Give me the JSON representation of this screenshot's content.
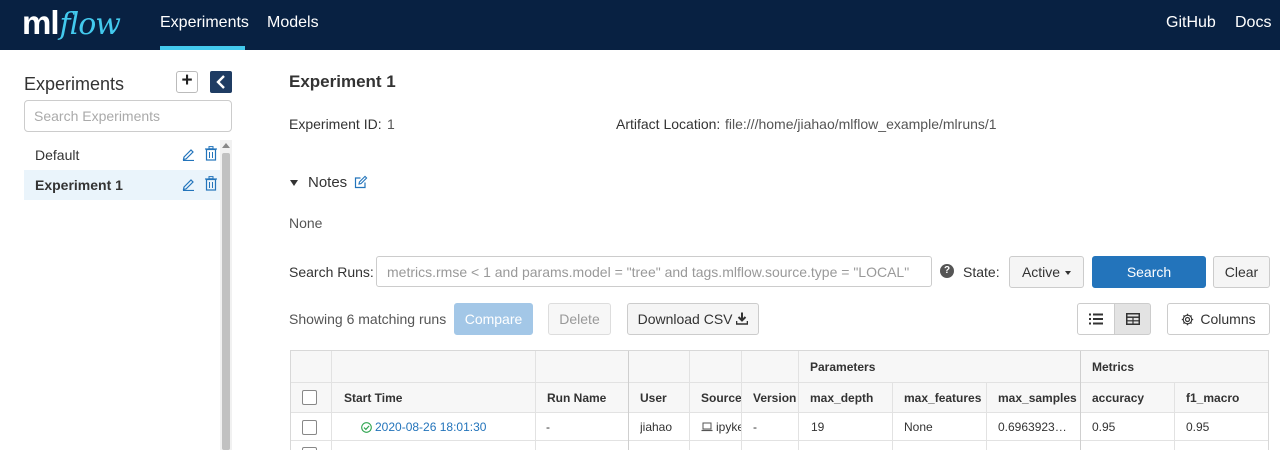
{
  "nav": {
    "logo_ml": "ml",
    "logo_flow": "flow",
    "experiments": "Experiments",
    "models": "Models",
    "github": "GitHub",
    "docs": "Docs"
  },
  "sidebar": {
    "title": "Experiments",
    "add_label": "+",
    "search_placeholder": "Search Experiments",
    "items": [
      {
        "name": "Default",
        "active": false
      },
      {
        "name": "Experiment 1",
        "active": true
      }
    ]
  },
  "experiment": {
    "title": "Experiment 1",
    "id_label": "Experiment ID:",
    "id_value": "1",
    "artifact_label": "Artifact Location:",
    "artifact_value": "file:///home/jiahao/mlflow_example/mlruns/1",
    "notes_label": "Notes",
    "notes_value": "None"
  },
  "search": {
    "label": "Search Runs:",
    "placeholder": "metrics.rmse < 1 and params.model = \"tree\" and tags.mlflow.source.type = \"LOCAL\"",
    "help": "?",
    "state_label": "State:",
    "state_value": "Active",
    "search_button": "Search",
    "clear_button": "Clear"
  },
  "toolbar": {
    "showing": "Showing 6 matching runs",
    "compare": "Compare",
    "delete": "Delete",
    "download": "Download CSV",
    "columns": "Columns"
  },
  "table": {
    "groups": {
      "parameters": "Parameters",
      "metrics": "Metrics"
    },
    "headers": {
      "start_time": "Start Time",
      "run_name": "Run Name",
      "user": "User",
      "source": "Source",
      "version": "Version",
      "max_depth": "max_depth",
      "max_features": "max_features",
      "max_samples": "max_samples",
      "accuracy": "accuracy",
      "f1_macro": "f1_macro"
    },
    "rows": [
      {
        "start_time": "2020-08-26 18:01:30",
        "run_name": "-",
        "user": "jiahao",
        "source": "ipykernel",
        "version": "-",
        "max_depth": "19",
        "max_features": "None",
        "max_samples": "0.6963923…",
        "accuracy": "0.95",
        "f1_macro": "0.95"
      }
    ]
  },
  "colors": {
    "nav_bg": "#082142",
    "accent": "#43c9ed",
    "primary": "#2374bb",
    "success": "#2ea44f"
  }
}
